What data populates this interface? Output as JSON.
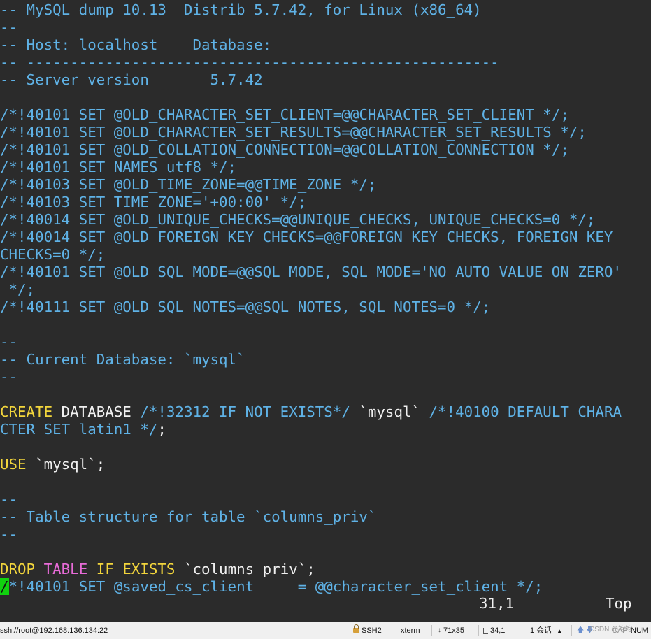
{
  "terminal": {
    "lines": [
      [
        {
          "t": "-- MySQL dump 10.13  Distrib 5.7.42, for Linux (x86_64)",
          "c": "cmt"
        }
      ],
      [
        {
          "t": "--",
          "c": "cmt"
        }
      ],
      [
        {
          "t": "-- Host: localhost    Database:",
          "c": "cmt"
        }
      ],
      [
        {
          "t": "-- ------------------------------------------------------",
          "c": "cmt"
        }
      ],
      [
        {
          "t": "-- Server version       5.7.42",
          "c": "cmt"
        }
      ],
      [
        {
          "t": "",
          "c": "cmt"
        }
      ],
      [
        {
          "t": "/*!40101 SET @OLD_CHARACTER_SET_CLIENT=@@CHARACTER_SET_CLIENT */;",
          "c": "cmt"
        }
      ],
      [
        {
          "t": "/*!40101 SET @OLD_CHARACTER_SET_RESULTS=@@CHARACTER_SET_RESULTS */;",
          "c": "cmt"
        }
      ],
      [
        {
          "t": "/*!40101 SET @OLD_COLLATION_CONNECTION=@@COLLATION_CONNECTION */;",
          "c": "cmt"
        }
      ],
      [
        {
          "t": "/*!40101 SET NAMES utf8 */;",
          "c": "cmt"
        }
      ],
      [
        {
          "t": "/*!40103 SET @OLD_TIME_ZONE=@@TIME_ZONE */;",
          "c": "cmt"
        }
      ],
      [
        {
          "t": "/*!40103 SET TIME_ZONE='+00:00' */;",
          "c": "cmt"
        }
      ],
      [
        {
          "t": "/*!40014 SET @OLD_UNIQUE_CHECKS=@@UNIQUE_CHECKS, UNIQUE_CHECKS=0 */;",
          "c": "cmt"
        }
      ],
      [
        {
          "t": "/*!40014 SET @OLD_FOREIGN_KEY_CHECKS=@@FOREIGN_KEY_CHECKS, FOREIGN_KEY_",
          "c": "cmt"
        }
      ],
      [
        {
          "t": "CHECKS=0 */;",
          "c": "cmt"
        }
      ],
      [
        {
          "t": "/*!40101 SET @OLD_SQL_MODE=@@SQL_MODE, SQL_MODE='NO_AUTO_VALUE_ON_ZERO'",
          "c": "cmt"
        }
      ],
      [
        {
          "t": " */;",
          "c": "cmt"
        }
      ],
      [
        {
          "t": "/*!40111 SET @OLD_SQL_NOTES=@@SQL_NOTES, SQL_NOTES=0 */;",
          "c": "cmt"
        }
      ],
      [
        {
          "t": "",
          "c": "cmt"
        }
      ],
      [
        {
          "t": "--",
          "c": "cmt"
        }
      ],
      [
        {
          "t": "-- Current Database: `mysql`",
          "c": "cmt"
        }
      ],
      [
        {
          "t": "--",
          "c": "cmt"
        }
      ],
      [
        {
          "t": "",
          "c": "cmt"
        }
      ],
      [
        {
          "t": "CREATE",
          "c": "kw"
        },
        {
          "t": " DATABASE ",
          "c": "txt"
        },
        {
          "t": "/*!32312 IF NOT EXISTS*/",
          "c": "cmt"
        },
        {
          "t": " `mysql` ",
          "c": "txt"
        },
        {
          "t": "/*!40100 DEFAULT CHARA",
          "c": "cmt"
        }
      ],
      [
        {
          "t": "CTER SET latin1 */",
          "c": "cmt"
        },
        {
          "t": ";",
          "c": "txt"
        }
      ],
      [
        {
          "t": "",
          "c": "cmt"
        }
      ],
      [
        {
          "t": "USE",
          "c": "kw"
        },
        {
          "t": " `mysql`;",
          "c": "txt"
        }
      ],
      [
        {
          "t": "",
          "c": "cmt"
        }
      ],
      [
        {
          "t": "--",
          "c": "cmt"
        }
      ],
      [
        {
          "t": "-- Table structure for table `columns_priv`",
          "c": "cmt"
        }
      ],
      [
        {
          "t": "--",
          "c": "cmt"
        }
      ],
      [
        {
          "t": "",
          "c": "cmt"
        }
      ],
      [
        {
          "t": "DROP",
          "c": "kw"
        },
        {
          "t": " ",
          "c": "txt"
        },
        {
          "t": "TABLE",
          "c": "kw2"
        },
        {
          "t": " ",
          "c": "txt"
        },
        {
          "t": "IF EXISTS",
          "c": "kw"
        },
        {
          "t": " `columns_priv`;",
          "c": "txt"
        }
      ],
      [
        {
          "t": "/",
          "c": "cursor"
        },
        {
          "t": "*!40101 SET @saved_cs_client     = @@character_set_client */;",
          "c": "cmt"
        }
      ]
    ],
    "ruler_position": "31,1",
    "ruler_percent": "Top"
  },
  "statusbar": {
    "session": "ssh://root@192.168.136.134:22",
    "protocol": "SSH2",
    "term_type": "xterm",
    "size": "71x35",
    "cursor": "34,1",
    "sessions": "1 会话",
    "caps": "CAP",
    "num": "NUM",
    "watermark": "CSDN @袍袍"
  }
}
